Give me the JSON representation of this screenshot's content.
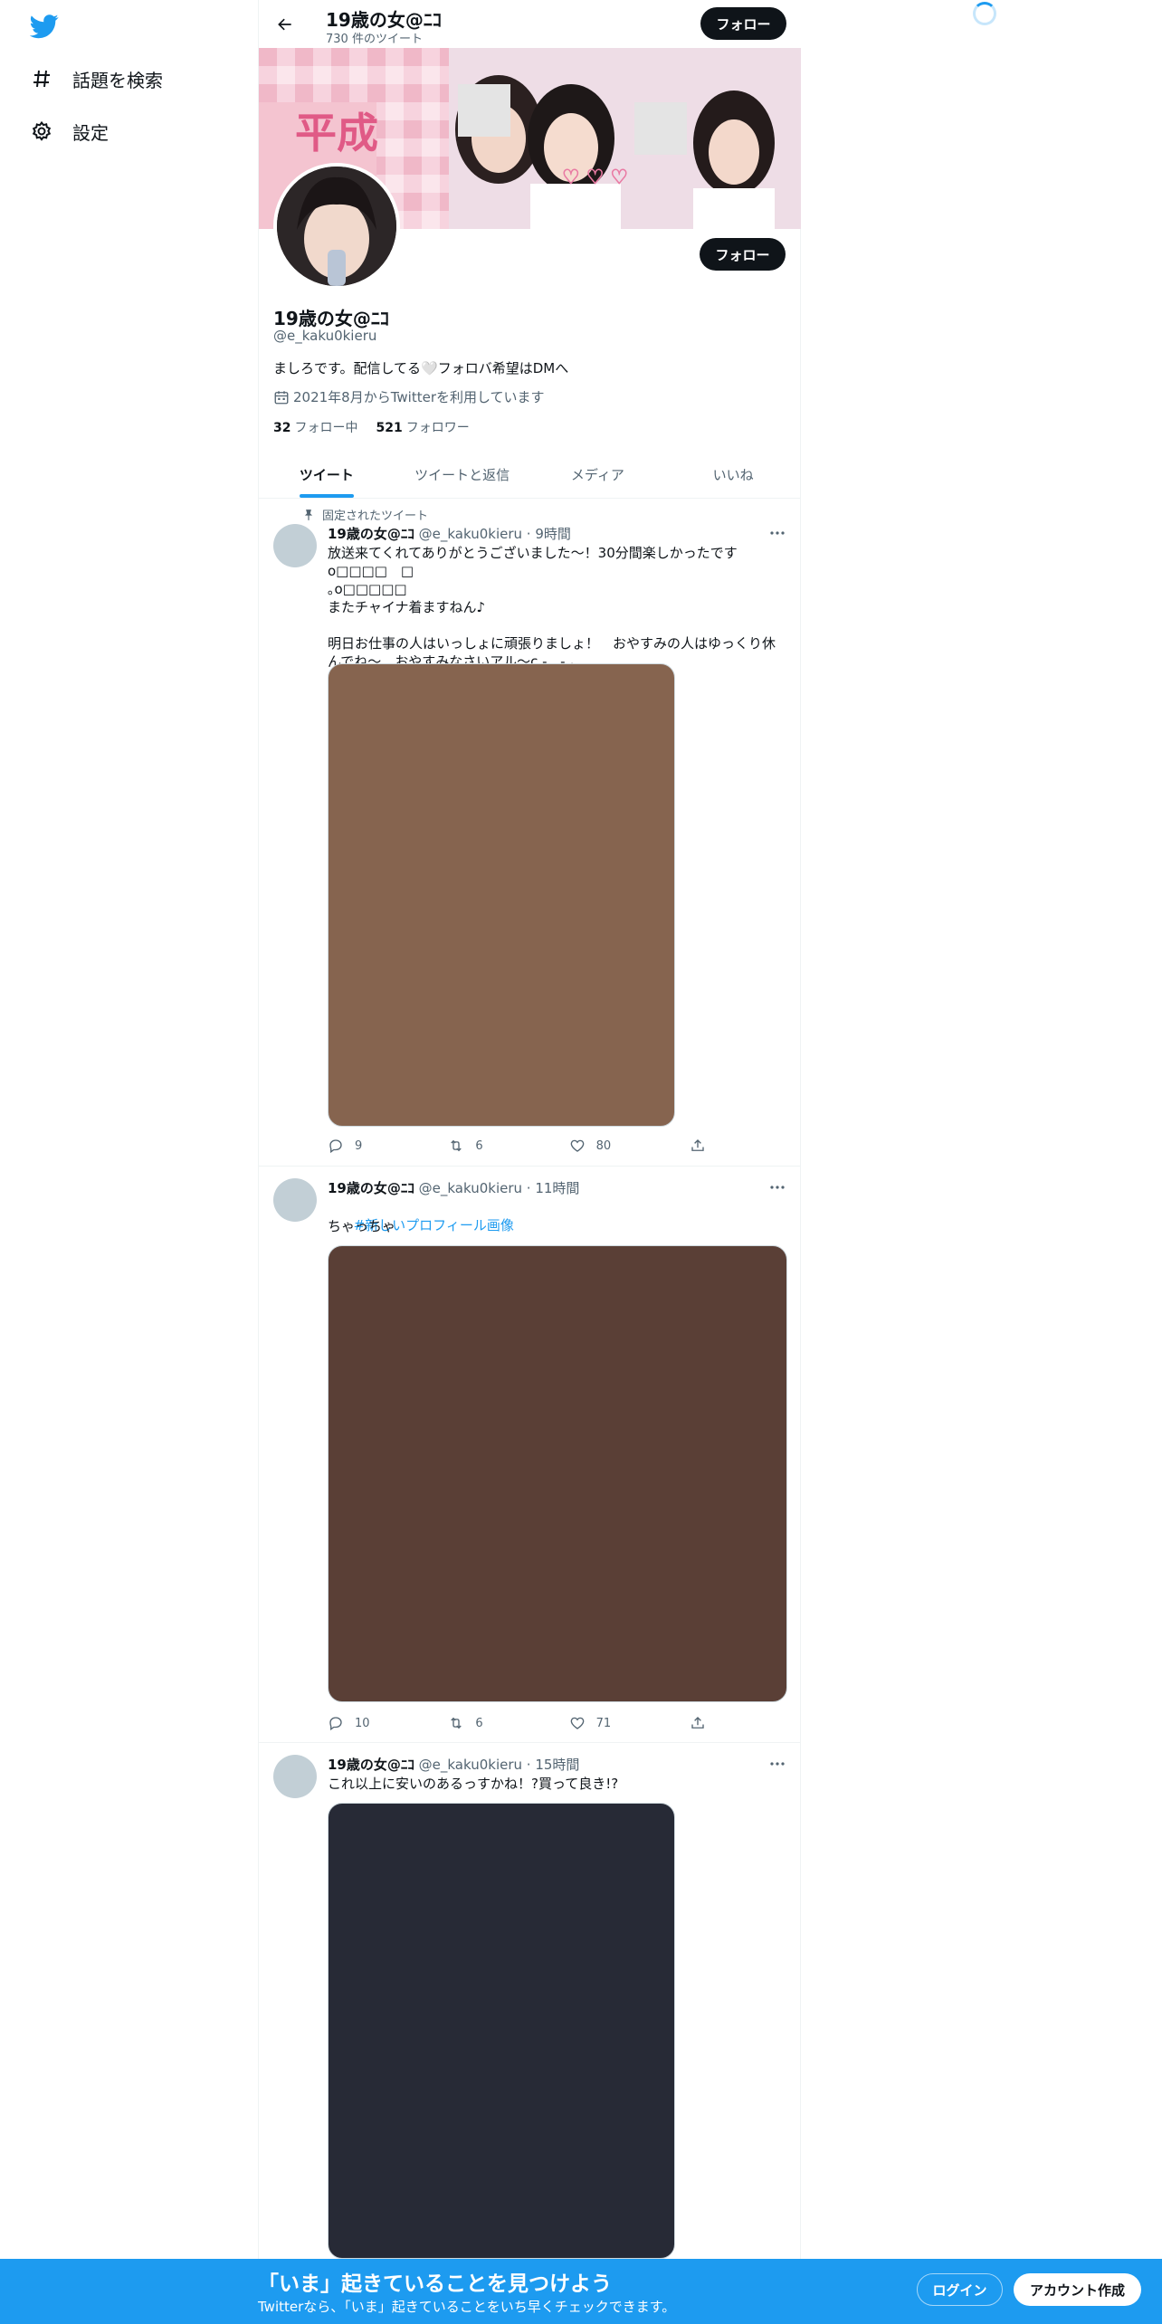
{
  "nav": {
    "explore_label": "話題を検索",
    "settings_label": "設定"
  },
  "header": {
    "name": "19歳の女@ﾆｺ",
    "tweet_count": "730 件のツイート",
    "follow_label": "フォロー"
  },
  "profile": {
    "name": "19歳の女@ﾆｺ",
    "handle": "@e_kaku0kieru",
    "bio": "ましろです。配信してる🤍フォロバ希望はDMへ",
    "joined": "2021年8月からTwitterを利用しています",
    "following_count": "32",
    "following_label": "フォロー中",
    "followers_count": "521",
    "followers_label": "フォロワー",
    "follow_label": "フォロー"
  },
  "tabs": [
    "ツイート",
    "ツイートと返信",
    "メディア",
    "いいね"
  ],
  "tweets": [
    {
      "pinned_label": "固定されたツイート",
      "name": "19歳の女@ﾆｺ",
      "meta": "@e_kaku0kieru · 9時間",
      "text": "放送来てくれてありがとうございました〜！30分間楽しかったですo□□□□　□\n｡o□□□□□\nまたチャイナ着ますねん♪\n\n明日お仕事の人はいっしょに頑張りましょ！　おやすみの人はゆっくり休\nんでね〜　おやすみなさいアル〜c - ‸ - ｡",
      "media_color": "#86644f",
      "replies": "9",
      "retweets": "6",
      "likes": "80"
    },
    {
      "name": "19歳の女@ﾆｺ",
      "meta": "@e_kaku0kieru · 11時間",
      "hashtag": "#新しいプロフィール画像",
      "text": "ちゃっちゃ",
      "media_color": "#5a3f36",
      "replies": "10",
      "retweets": "6",
      "likes": "71"
    },
    {
      "name": "19歳の女@ﾆｺ",
      "meta": "@e_kaku0kieru · 15時間",
      "text": "これ以上に安いのあるっすかね！?買って良き!?",
      "media_color": "#272a36"
    }
  ],
  "bottom": {
    "title": "「いま」起きていることを見つけよう",
    "subtitle": "Twitterなら、「いま」起きていることをいち早くチェックできます。",
    "login_label": "ログイン",
    "signup_label": "アカウント作成"
  },
  "colors": {
    "accent": "#1d9bf0",
    "text": "#0f1419",
    "muted": "#536471",
    "button_dark": "#0f1419"
  },
  "icons": [
    "twitter-bird-icon",
    "hashtag-icon",
    "gear-icon",
    "back-arrow-icon",
    "calendar-icon",
    "pin-icon",
    "more-icon",
    "reply-icon",
    "retweet-icon",
    "like-icon",
    "share-icon",
    "loading-spinner-icon"
  ]
}
